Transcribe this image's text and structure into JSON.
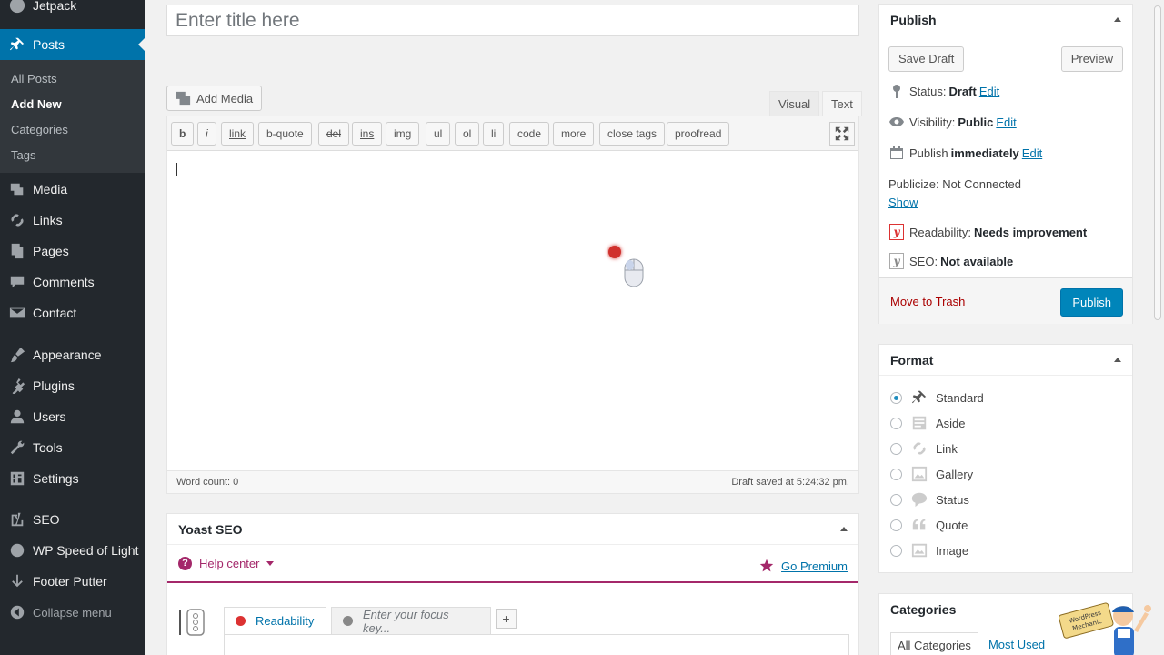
{
  "sidebar": {
    "items": [
      {
        "label": "Jetpack",
        "icon": "jetpack-icon"
      },
      {
        "label": "Posts",
        "icon": "pin-icon"
      },
      {
        "label": "Media",
        "icon": "media-icon"
      },
      {
        "label": "Links",
        "icon": "links-icon"
      },
      {
        "label": "Pages",
        "icon": "pages-icon"
      },
      {
        "label": "Comments",
        "icon": "comments-icon"
      },
      {
        "label": "Contact",
        "icon": "mail-icon"
      },
      {
        "label": "Appearance",
        "icon": "brush-icon"
      },
      {
        "label": "Plugins",
        "icon": "plugin-icon"
      },
      {
        "label": "Users",
        "icon": "users-icon"
      },
      {
        "label": "Tools",
        "icon": "wrench-icon"
      },
      {
        "label": "Settings",
        "icon": "settings-icon"
      },
      {
        "label": "SEO",
        "icon": "yoast-icon"
      },
      {
        "label": "WP Speed of Light",
        "icon": "speed-icon"
      },
      {
        "label": "Footer Putter",
        "icon": "arrow-down-icon"
      },
      {
        "label": "Collapse menu",
        "icon": "collapse-icon"
      }
    ],
    "submenu": [
      "All Posts",
      "Add New",
      "Categories",
      "Tags"
    ]
  },
  "editor": {
    "title_placeholder": "Enter title here",
    "add_media": "Add Media",
    "tab_visual": "Visual",
    "tab_text": "Text",
    "quicktags": [
      "b",
      "i",
      "link",
      "b-quote",
      "del",
      "ins",
      "img",
      "ul",
      "ol",
      "li",
      "code",
      "more",
      "close tags",
      "proofread"
    ],
    "word_count": "Word count: 0",
    "draft_saved": "Draft saved at 5:24:32 pm."
  },
  "yoast": {
    "title": "Yoast SEO",
    "help_center": "Help center",
    "go_premium": "Go Premium",
    "tab_readability": "Readability",
    "focus_placeholder": "Enter your focus key...",
    "add": "+"
  },
  "publish": {
    "title": "Publish",
    "save_draft": "Save Draft",
    "preview": "Preview",
    "status_label": "Status:",
    "status_value": "Draft",
    "visibility_label": "Visibility:",
    "visibility_value": "Public",
    "publish_label": "Publish",
    "publish_value": "immediately",
    "edit": "Edit",
    "publicize": "Publicize: Not Connected",
    "show": "Show",
    "readability_label": "Readability:",
    "readability_value": "Needs improvement",
    "seo_label": "SEO:",
    "seo_value": "Not available",
    "move_to_trash": "Move to Trash",
    "publish_button": "Publish"
  },
  "format": {
    "title": "Format",
    "options": [
      "Standard",
      "Aside",
      "Link",
      "Gallery",
      "Status",
      "Quote",
      "Image"
    ],
    "selected": "Standard"
  },
  "categories": {
    "title": "Categories",
    "tab_all": "All Categories",
    "tab_most_used": "Most Used"
  },
  "mascot": {
    "text": "WordPress Mechanic"
  },
  "colors": {
    "sidebar": "#23282d",
    "accent": "#0073aa",
    "yoast": "#a4286a",
    "trash": "#aa0000"
  }
}
